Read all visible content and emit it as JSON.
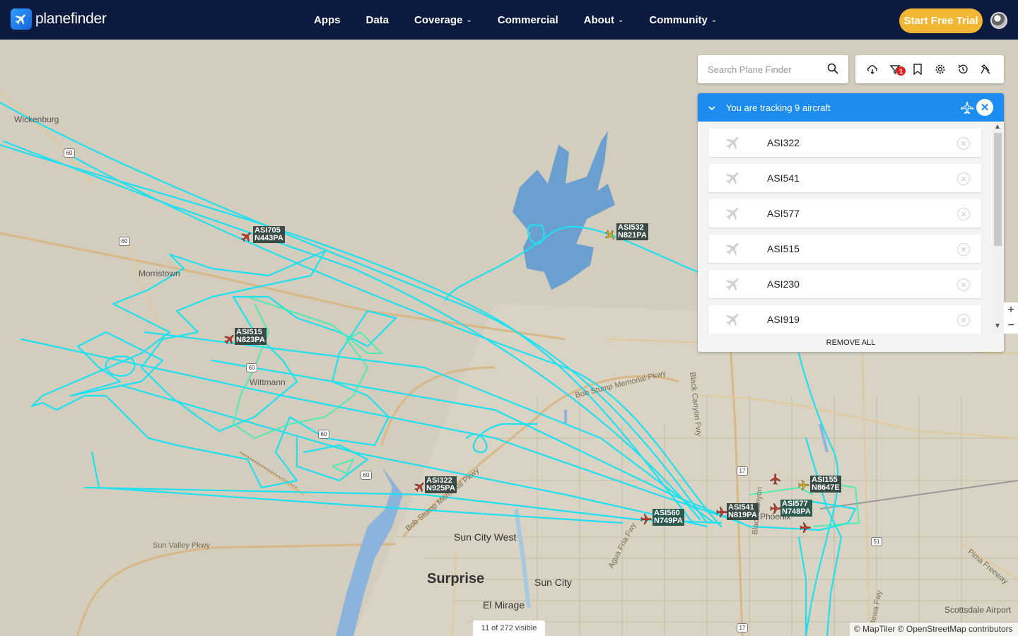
{
  "brand": {
    "name": "planefinder"
  },
  "nav": {
    "items": [
      {
        "label": "Apps",
        "has_dropdown": false
      },
      {
        "label": "Data",
        "has_dropdown": false
      },
      {
        "label": "Coverage",
        "has_dropdown": true
      },
      {
        "label": "Commercial",
        "has_dropdown": false
      },
      {
        "label": "About",
        "has_dropdown": true
      },
      {
        "label": "Community",
        "has_dropdown": true
      }
    ],
    "trial_button": "Start Free Trial",
    "trial_color": "#f2b632",
    "bg_color": "#0b1a3e"
  },
  "search": {
    "placeholder": "Search Plane Finder"
  },
  "toolbar": {
    "icons": [
      "weather-icon",
      "filter-icon",
      "bookmark-icon",
      "settings-icon",
      "history-icon",
      "playback-icon"
    ],
    "filter_badge": "1"
  },
  "tracking": {
    "title": "You are tracking 9 aircraft",
    "aircraft": [
      "ASI322",
      "ASI541",
      "ASI577",
      "ASI515",
      "ASI230",
      "ASI919"
    ],
    "remove_all": "REMOVE ALL",
    "header_color": "#1c8cf0"
  },
  "map": {
    "places": {
      "wickenburg": "Wickenburg",
      "morristown": "Morristown",
      "wittmann": "Wittmann",
      "sun_city_west": "Sun City West",
      "surprise": "Surprise",
      "sun_city": "Sun City",
      "el_mirage": "El Mirage",
      "phoenix": "Phoenix",
      "scottsdale_airport": "Scottsdale Airport"
    },
    "roads": {
      "bob_stump": "Bob Stump Memorial Pkwy",
      "bob_stump2": "Bob Stump Memorial Pkwy",
      "black_canyon": "Black Canyon Fwy",
      "black_canyon2": "Black Canyon",
      "agua_fria": "Agua Fria Fwy",
      "sun_valley": "Sun Valley Pkwy",
      "pima": "Pima Freeway",
      "stewa": "Stewa Fwy"
    },
    "shields": [
      "60",
      "60",
      "60",
      "60",
      "60",
      "17",
      "17",
      "51"
    ],
    "aircraft_labels": [
      {
        "flight": "ASI705",
        "reg": "N443PA"
      },
      {
        "flight": "ASI532",
        "reg": "N821PA"
      },
      {
        "flight": "ASI515",
        "reg": "N823PA"
      },
      {
        "flight": "ASI322",
        "reg": "N925PA"
      },
      {
        "flight": "ASI560",
        "reg": "N749PA"
      },
      {
        "flight": "ASI541",
        "reg": "N819PA"
      },
      {
        "flight": "ASI577",
        "reg": "N748PA"
      },
      {
        "flight": "ASI155",
        "reg": "N8647E"
      }
    ],
    "visible_count": "11 of 272 visible",
    "attribution": "© MapTiler © OpenStreetMap contributors",
    "track_color": "#1fe0f0",
    "track_color_alt": "#3af0b0",
    "lake_color": "#6a9fd0"
  }
}
